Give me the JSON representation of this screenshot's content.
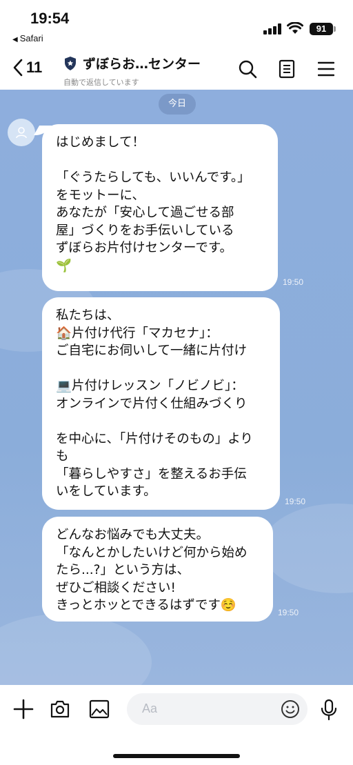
{
  "status_bar": {
    "time": "19:54",
    "back_app": "Safari",
    "battery": "91"
  },
  "header": {
    "back_count": "11",
    "title": "ずぼらお…センター",
    "subtitle": "自動で返信しています",
    "icons": [
      "search-icon",
      "notes-icon",
      "menu-icon"
    ]
  },
  "chat": {
    "date_label": "今日",
    "messages": [
      {
        "text": "はじめまして！\n\n「ぐうたらしても、いいんです。」\nをモットーに、\nあなたが「安心して過ごせる部\n屋」づくりをお手伝いしている\nずぼらお片付けセンターです。\n🌱",
        "time": "19:50"
      },
      {
        "text": "私たちは、\n🏠片付け代行「マカセナ」：\nご自宅にお伺いして一緒に片付け\n\n💻片付けレッスン「ノビノビ」：\nオンラインで片付く仕組みづくり\n\nを中心に、「片付けそのもの」より\nも\n「暮らしやすさ」を整えるお手伝\nいをしています。",
        "time": "19:50"
      },
      {
        "text": "どんなお悩みでも大丈夫。\n「なんとかしたいけど何から始め\nたら...?」という方は、\nぜひご相談ください!\nきっとホッとできるはずです☺️",
        "time": "19:50"
      }
    ]
  },
  "input": {
    "placeholder": "Aa",
    "icons": [
      "plus-icon",
      "camera-icon",
      "image-icon",
      "emoji-icon",
      "microphone-icon"
    ]
  },
  "colors": {
    "chat_bg": "#8eaedd",
    "bubble": "#ffffff",
    "timestamp": "#eef2f8"
  }
}
